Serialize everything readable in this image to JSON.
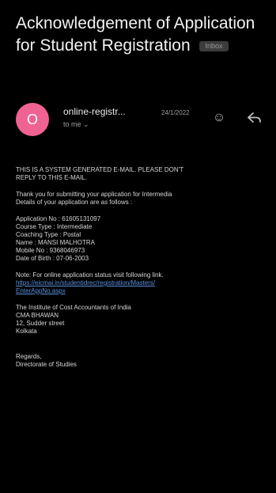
{
  "email": {
    "subject": "Acknowledgement of Application for Student Registration",
    "label": "Inbox"
  },
  "sender": {
    "avatar_letter": "O",
    "name": "online-registr...",
    "date": "24/1/2022",
    "recipient": "to me",
    "emoji_icon": "smiley-icon",
    "reply_icon": "reply-icon",
    "avatar_color": "#f06292"
  },
  "body": {
    "system_notice": [
      "THIS IS A SYSTEM GENERATED E-MAIL. PLEASE DON'T",
      "REPLY TO THIS E-MAIL."
    ],
    "intro": [
      "Thank you for submitting your application for Intermedia",
      "Details of your application are as follows :"
    ],
    "details": [
      "Application No : 61605131097",
      "Course Type : Intermediate",
      "Coaching Type : Postal",
      "Name : MANSI MALHOTRA",
      "Mobile No : 9368046973",
      "Date of Birth : 07-06-2003"
    ],
    "note": "Note: For online application status visit following link.",
    "link": [
      "https://eicmai.in/studentidrec/registration/Masters/",
      "EnterAppNo.aspx"
    ],
    "address": [
      "The Institute of Cost Accountants of India",
      "CMA BHAWAN",
      "12, Sudder street",
      "Kolkata"
    ],
    "regards": [
      "Regards,",
      "Directorate of Studies"
    ]
  },
  "colors": {
    "background": "#000000",
    "link": "#5b8fde"
  }
}
